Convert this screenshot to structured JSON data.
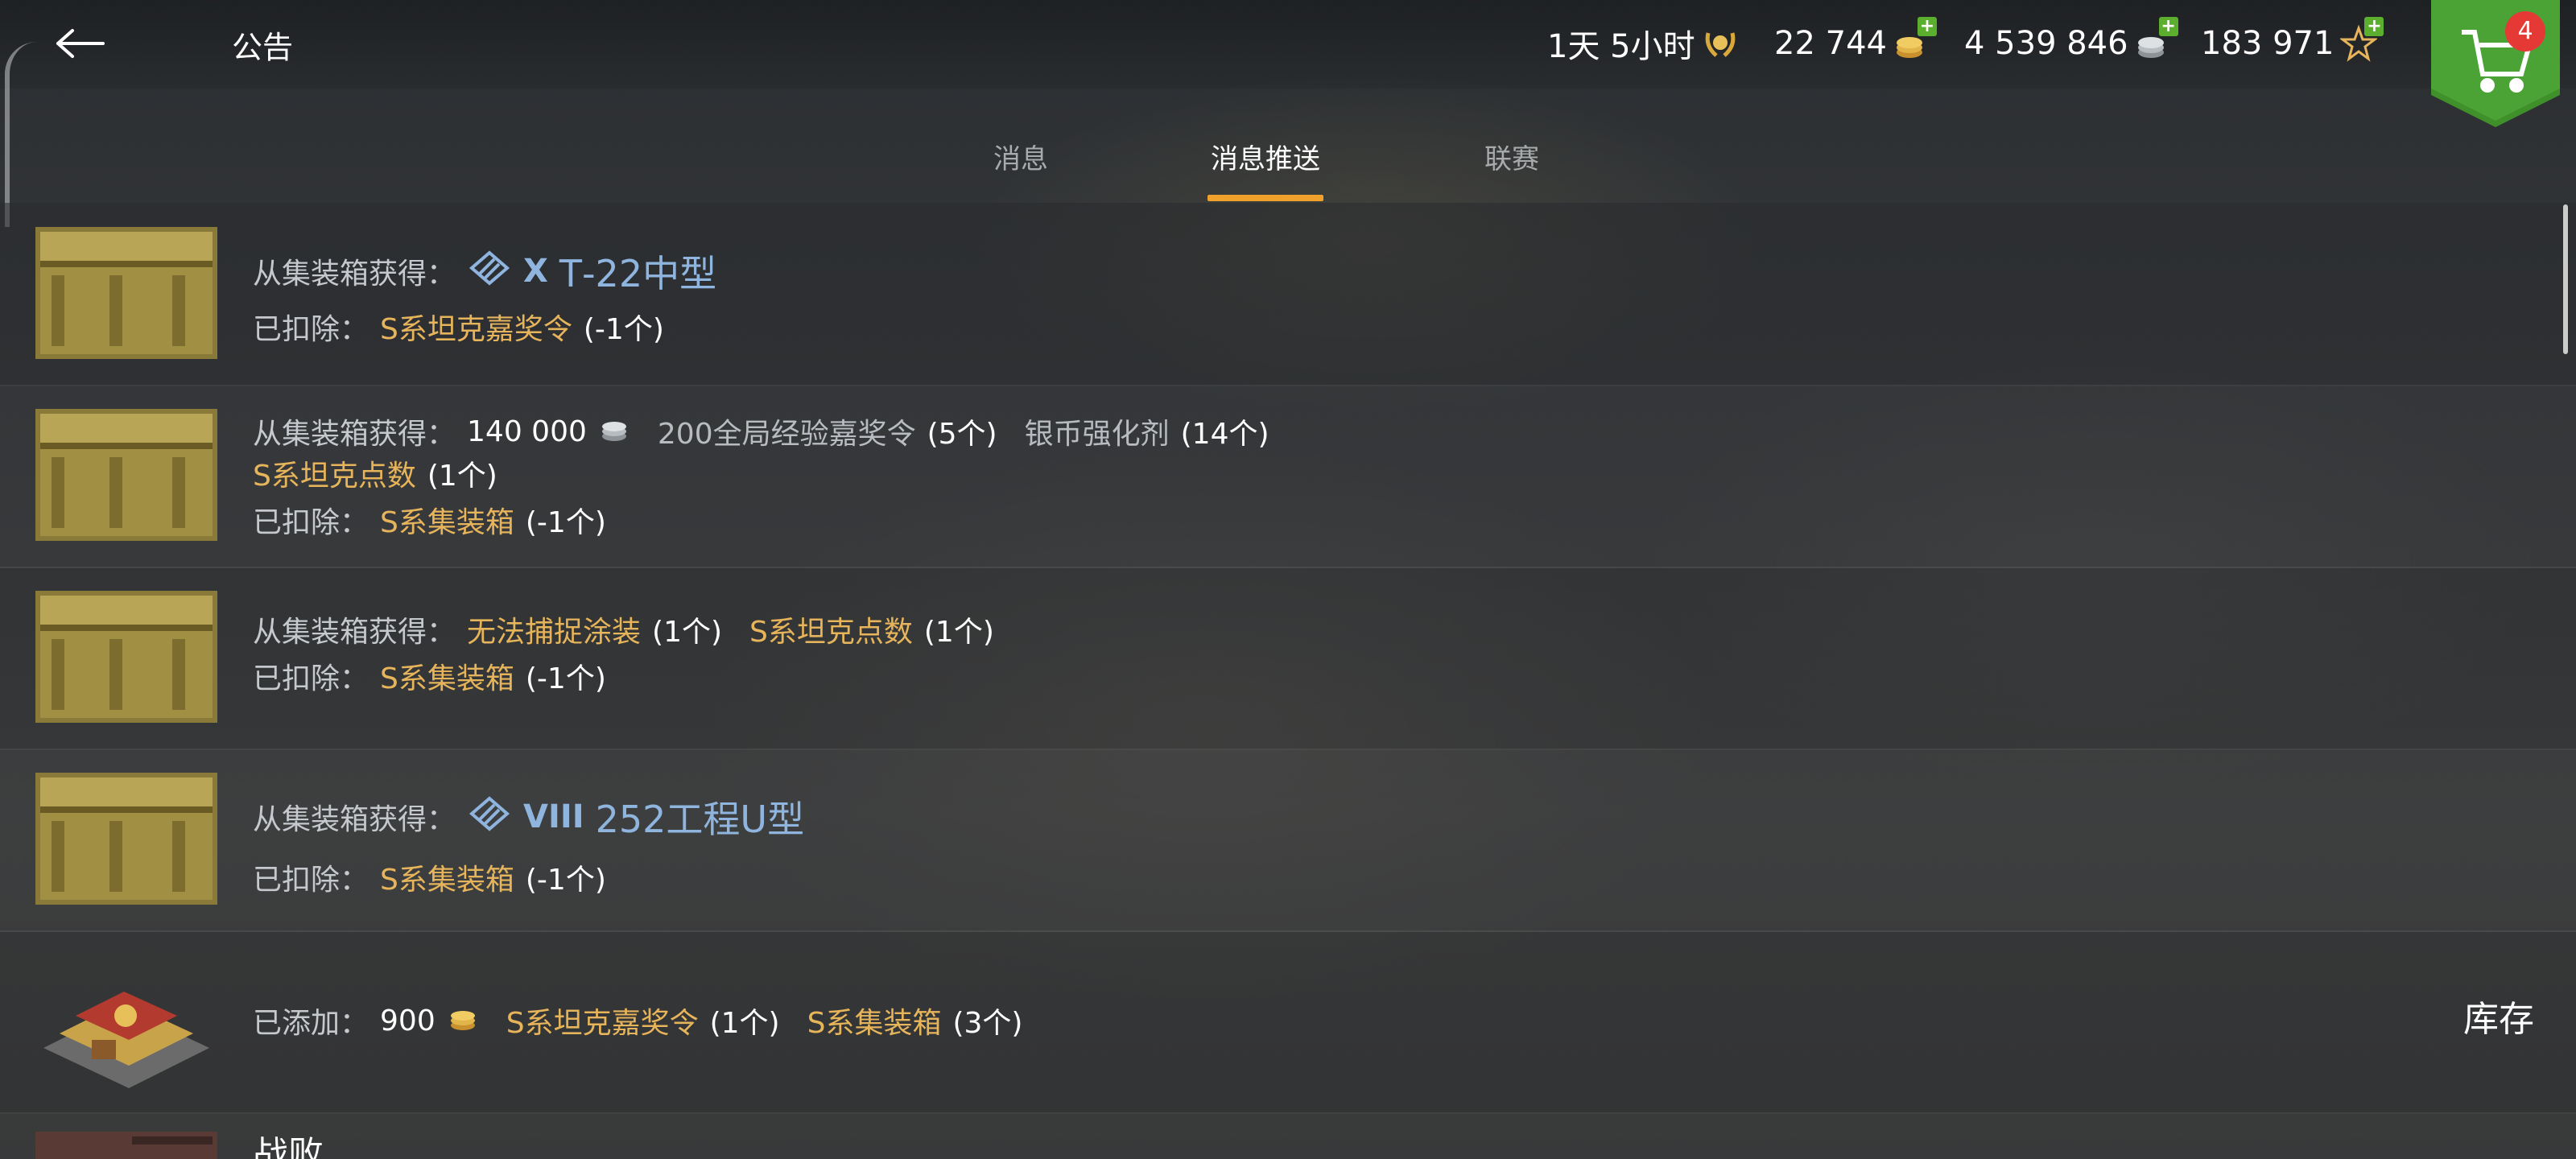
{
  "header": {
    "back_icon": "arrow-left-icon",
    "title": "公告",
    "premium_timer": "1天 5小时",
    "gold": "22 744",
    "silver": "4 539 846",
    "free_xp": "183 971",
    "shop_badge_count": "4"
  },
  "tabs": [
    {
      "label": "消息",
      "active": false
    },
    {
      "label": "消息推送",
      "active": true
    },
    {
      "label": "联赛",
      "active": false
    }
  ],
  "messages": [
    {
      "obtain_label": "从集装箱获得：",
      "tank_tier": "X",
      "tank_name": "Т-22中型",
      "deduct_label": "已扣除：",
      "deduct_item": "S系坦克嘉奖令",
      "deduct_qty": "(-1个)"
    },
    {
      "obtain_label": "从集装箱获得：",
      "silver_amount": "140 000",
      "item1": "200全局经验嘉奖令",
      "item1_qty": "(5个)",
      "item2": "银币强化剂",
      "item2_qty": "(14个)",
      "item3": "S系坦克点数",
      "item3_qty": "(1个)",
      "deduct_label": "已扣除：",
      "deduct_item": "S系集装箱",
      "deduct_qty": "(-1个)"
    },
    {
      "obtain_label": "从集装箱获得：",
      "item1": "无法捕捉涂装",
      "item1_qty": "(1个)",
      "item2": "S系坦克点数",
      "item2_qty": "(1个)",
      "deduct_label": "已扣除：",
      "deduct_item": "S系集装箱",
      "deduct_qty": "(-1个)"
    },
    {
      "obtain_label": "从集装箱获得：",
      "tank_tier": "VIII",
      "tank_name": "252工程U型",
      "deduct_label": "已扣除：",
      "deduct_item": "S系集装箱",
      "deduct_qty": "(-1个)"
    },
    {
      "added_label": "已添加：",
      "gold_amount": "900",
      "item1": "S系坦克嘉奖令",
      "item1_qty": "(1个)",
      "item2": "S系集装箱",
      "item2_qty": "(3个)",
      "action_label": "库存"
    },
    {
      "title": "战败"
    }
  ],
  "colors": {
    "accent_underline": "#f0a12b",
    "item_gold": "#e6b45a",
    "tank_blue": "#8fb5df",
    "badge_red": "#e53935",
    "shop_green": "#3f8f2b"
  }
}
